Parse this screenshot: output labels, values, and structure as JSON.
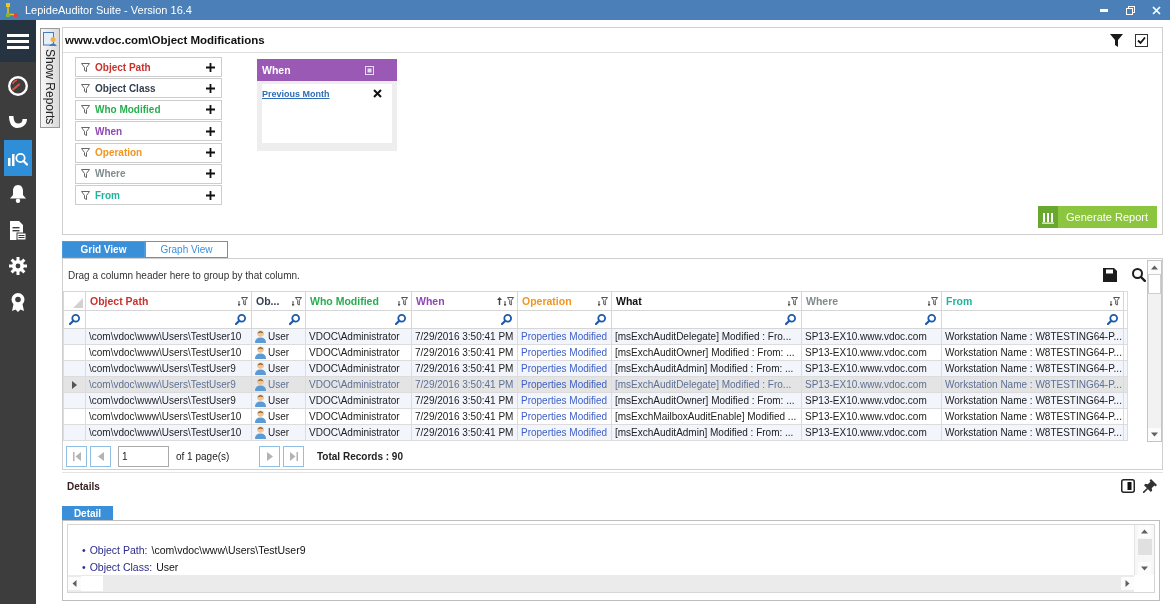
{
  "window": {
    "title": "LepideAuditor Suite - Version 16.4"
  },
  "sidebar": {
    "items": [
      {
        "kind": "gauge",
        "selected": false
      },
      {
        "kind": "cup",
        "selected": false
      },
      {
        "kind": "chart-search",
        "selected": true
      },
      {
        "kind": "bell",
        "selected": false
      },
      {
        "kind": "document",
        "selected": false
      },
      {
        "kind": "gear",
        "selected": false
      },
      {
        "kind": "award",
        "selected": false
      }
    ]
  },
  "side_tab": {
    "label": "Show Reports"
  },
  "report": {
    "title": "www.vdoc.com\\Object Modifications",
    "filters": [
      {
        "label": "Object Path",
        "color": "#c8322d"
      },
      {
        "label": "Object Class",
        "color": "#34404f"
      },
      {
        "label": "Who Modified",
        "color": "#27ae4f"
      },
      {
        "label": "When",
        "color": "#9146b3"
      },
      {
        "label": "Operation",
        "color": "#f0961e"
      },
      {
        "label": "Where",
        "color": "#7f8c8d"
      },
      {
        "label": "From",
        "color": "#1eb59c"
      }
    ],
    "active_filter": {
      "title": "When",
      "value": "Previous Month"
    },
    "generate_button": "Generate Report"
  },
  "view_tabs": [
    {
      "label": "Grid View",
      "selected": true
    },
    {
      "label": "Graph View",
      "selected": false
    }
  ],
  "grid": {
    "group_hint": "Drag a column header here to group by that column.",
    "columns": [
      {
        "label": "Object Path",
        "color": "#c8322d",
        "kind": "text",
        "sorted": false
      },
      {
        "label": "Ob...",
        "color": "#34404f",
        "kind": "user",
        "sorted": false
      },
      {
        "label": "Who Modified",
        "color": "#27ae4f",
        "kind": "text",
        "sorted": false
      },
      {
        "label": "When",
        "color": "#9146b3",
        "kind": "text",
        "sorted": true
      },
      {
        "label": "Operation",
        "color": "#f0961e",
        "kind": "link",
        "sorted": false
      },
      {
        "label": "What",
        "color": "#111111",
        "kind": "text",
        "sorted": false
      },
      {
        "label": "Where",
        "color": "#7f8c8d",
        "kind": "text",
        "sorted": false
      },
      {
        "label": "From",
        "color": "#1eb59c",
        "kind": "text",
        "sorted": false
      }
    ],
    "rows": [
      {
        "selected": false,
        "cells": [
          "\\com\\vdoc\\www\\Users\\TestUser10",
          "User",
          "VDOC\\Administrator",
          "7/29/2016 3:50:41 PM",
          "Properties Modified",
          "[msExchAuditDelegate] Modified : Fro...",
          "SP13-EX10.www.vdoc.com",
          "Workstation Name : W8TESTING64-P..."
        ]
      },
      {
        "selected": false,
        "cells": [
          "\\com\\vdoc\\www\\Users\\TestUser10",
          "User",
          "VDOC\\Administrator",
          "7/29/2016 3:50:41 PM",
          "Properties Modified",
          "[msExchAuditOwner] Modified : From: ...",
          "SP13-EX10.www.vdoc.com",
          "Workstation Name : W8TESTING64-P..."
        ]
      },
      {
        "selected": false,
        "cells": [
          "\\com\\vdoc\\www\\Users\\TestUser9",
          "User",
          "VDOC\\Administrator",
          "7/29/2016 3:50:41 PM",
          "Properties Modified",
          "[msExchAuditAdmin] Modified : From: ...",
          "SP13-EX10.www.vdoc.com",
          "Workstation Name : W8TESTING64-P..."
        ]
      },
      {
        "selected": true,
        "cells": [
          "\\com\\vdoc\\www\\Users\\TestUser9",
          "User",
          "VDOC\\Administrator",
          "7/29/2016 3:50:41 PM",
          "Properties Modified",
          "[msExchAuditDelegate] Modified : Fro...",
          "SP13-EX10.www.vdoc.com",
          "Workstation Name : W8TESTING64-P..."
        ]
      },
      {
        "selected": false,
        "cells": [
          "\\com\\vdoc\\www\\Users\\TestUser9",
          "User",
          "VDOC\\Administrator",
          "7/29/2016 3:50:41 PM",
          "Properties Modified",
          "[msExchAuditOwner] Modified : From: ...",
          "SP13-EX10.www.vdoc.com",
          "Workstation Name : W8TESTING64-P..."
        ]
      },
      {
        "selected": false,
        "cells": [
          "\\com\\vdoc\\www\\Users\\TestUser10",
          "User",
          "VDOC\\Administrator",
          "7/29/2016 3:50:41 PM",
          "Properties Modified",
          "[msExchMailboxAuditEnable] Modified ...",
          "SP13-EX10.www.vdoc.com",
          "Workstation Name : W8TESTING64-P..."
        ]
      },
      {
        "selected": false,
        "cells": [
          "\\com\\vdoc\\www\\Users\\TestUser10",
          "User",
          "VDOC\\Administrator",
          "7/29/2016 3:50:41 PM",
          "Properties Modified",
          "[msExchAuditAdmin] Modified : From: ...",
          "SP13-EX10.www.vdoc.com",
          "Workstation Name : W8TESTING64-P..."
        ]
      }
    ]
  },
  "pager": {
    "page": "1",
    "page_count": "of 1 page(s)",
    "total": "Total Records : 90"
  },
  "details": {
    "heading": "Details",
    "tabs": [
      {
        "label": "Detail",
        "selected": true
      }
    ],
    "fields": [
      {
        "bullet": "•",
        "label": "Object Path:",
        "value": "\\com\\vdoc\\www\\Users\\TestUser9"
      },
      {
        "bullet": "•",
        "label": "Object Class:",
        "value": "User"
      }
    ]
  }
}
